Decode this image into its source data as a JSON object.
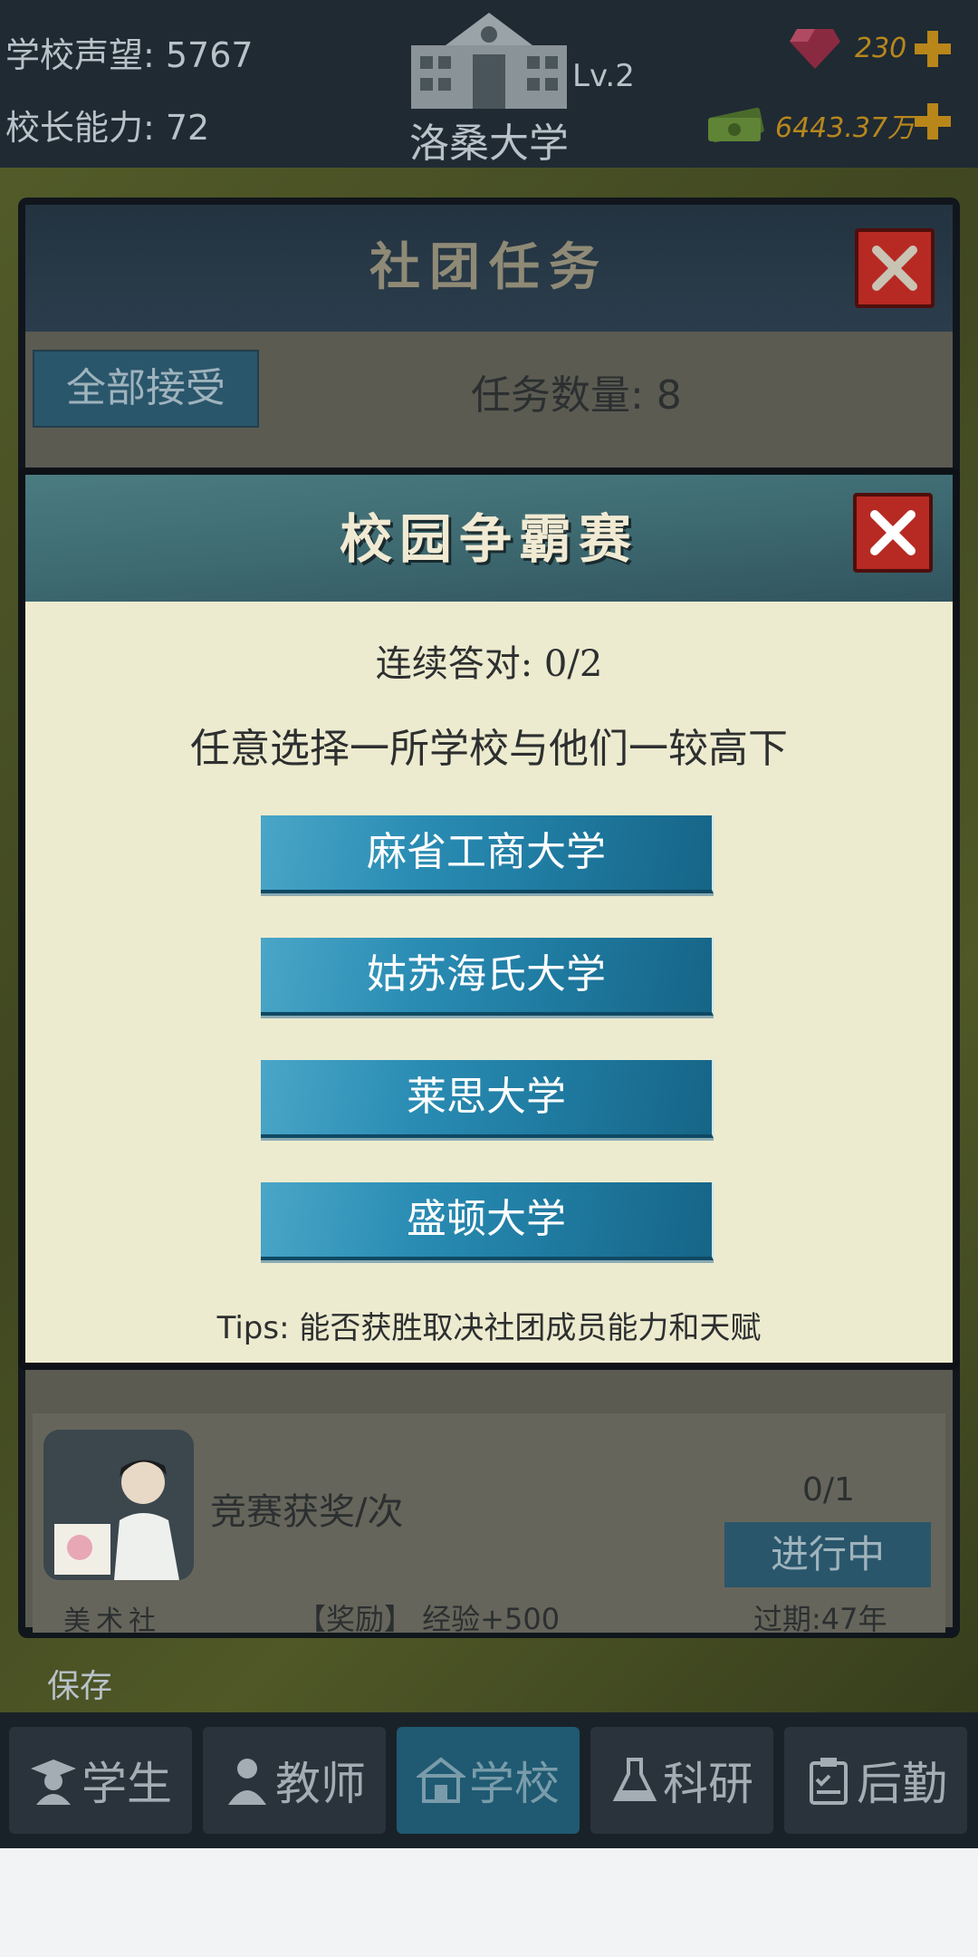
{
  "top_bar": {
    "reputation": "学校声望: 5767",
    "principal_ability": "校长能力: 72",
    "school_name": "洛桑大学",
    "level": "Lv.2",
    "gems": "230",
    "money": "6443.37万"
  },
  "club_panel": {
    "title": "社团任务",
    "accept_all": "全部接受",
    "task_count": "任务数量: 8",
    "task": {
      "name": "竞赛获奖/次",
      "progress": "0/1",
      "status": "进行中",
      "club": "美术社",
      "reward": "【奖励】 经验+500",
      "expire": "过期:47年"
    }
  },
  "modal": {
    "title": "校园争霸赛",
    "streak": "连续答对: 0/2",
    "instruction": "任意选择一所学校与他们一较高下",
    "schools": [
      "麻省工商大学",
      "姑苏海氏大学",
      "莱思大学",
      "盛顿大学"
    ],
    "tips": "Tips: 能否获胜取决社团成员能力和天赋"
  },
  "save_label": "保存",
  "nav": [
    "学生",
    "教师",
    "学校",
    "科研",
    "后勤"
  ],
  "colors": {
    "accent_blue": "#1f7aa0",
    "close_red": "#b72a24",
    "reward_orange": "#d36a20"
  }
}
